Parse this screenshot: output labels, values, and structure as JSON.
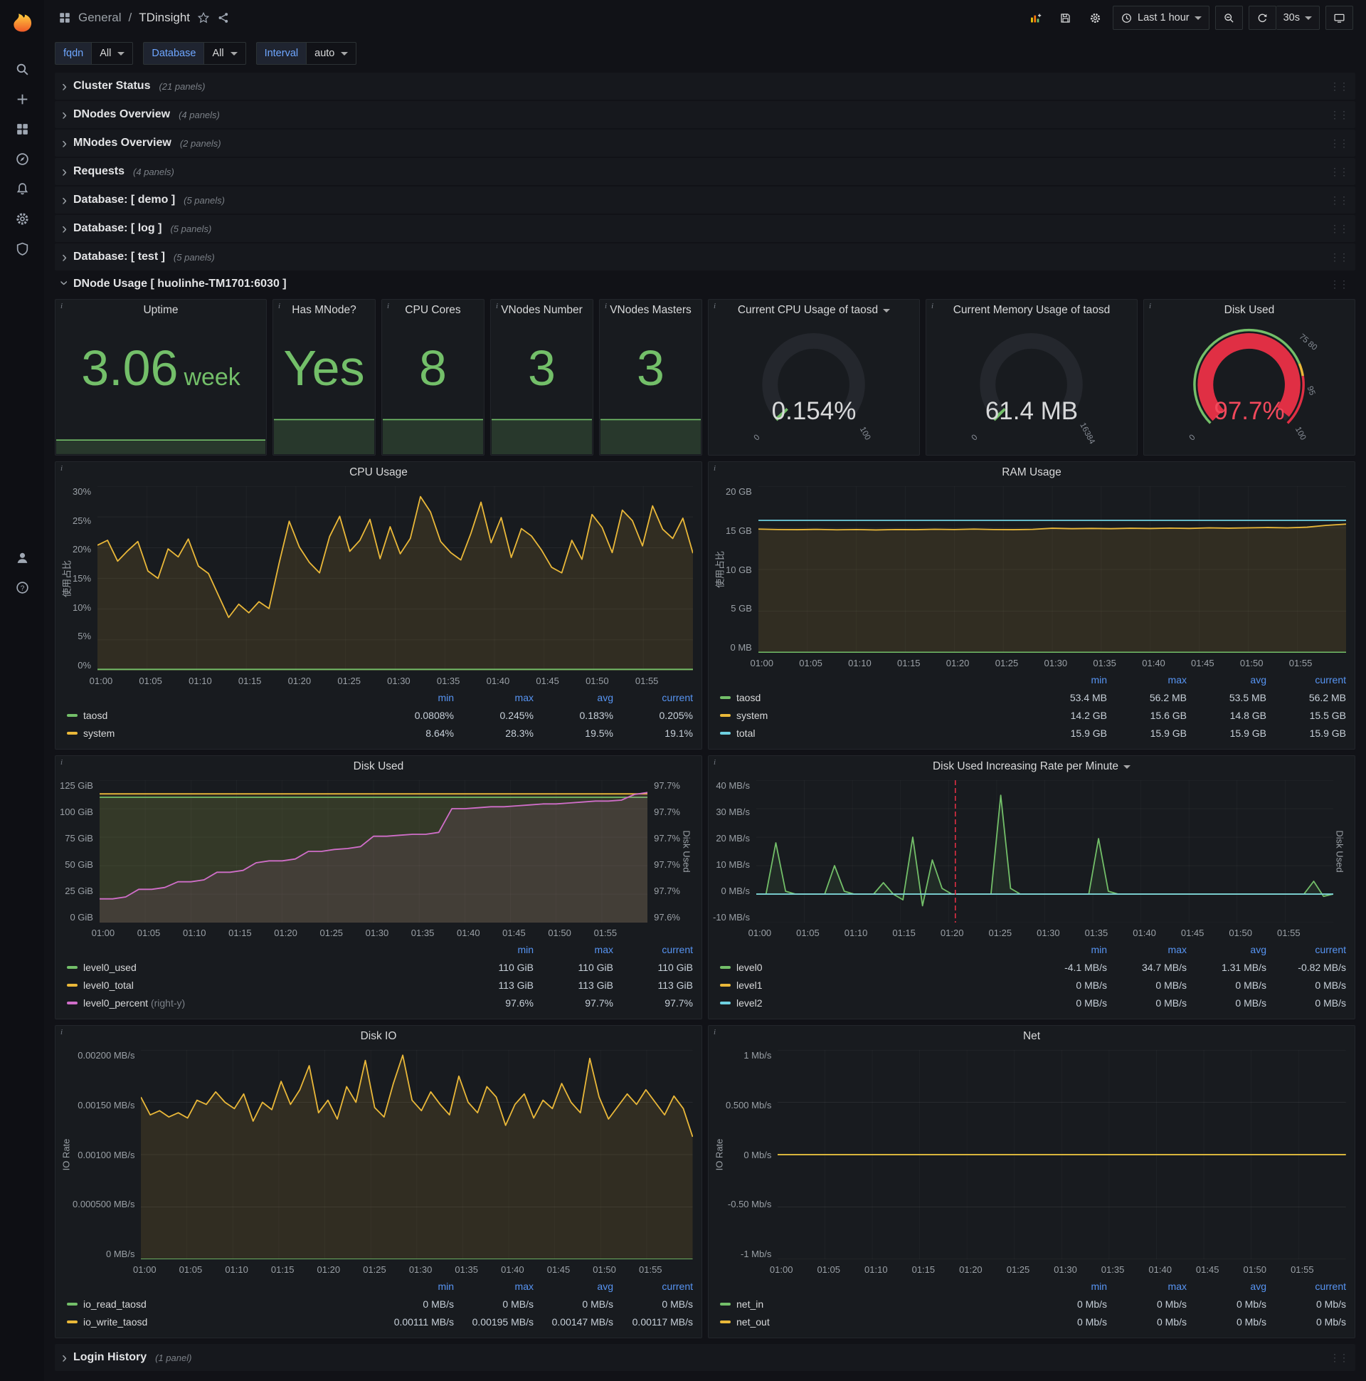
{
  "app": {
    "breadcrumb": {
      "section": "General",
      "divider": "/",
      "title": "TDinsight"
    },
    "toolbar": {
      "time_range": "Last 1 hour",
      "refresh": "30s"
    }
  },
  "variables": [
    {
      "label": "fqdn",
      "value": "All"
    },
    {
      "label": "Database",
      "value": "All"
    },
    {
      "label": "Interval",
      "value": "auto"
    }
  ],
  "collapsed_rows": [
    {
      "title": "Cluster Status",
      "count": "(21 panels)"
    },
    {
      "title": "DNodes Overview",
      "count": "(4 panels)"
    },
    {
      "title": "MNodes Overview",
      "count": "(2 panels)"
    },
    {
      "title": "Requests",
      "count": "(4 panels)"
    },
    {
      "title": "Database: [ demo ]",
      "count": "(5 panels)"
    },
    {
      "title": "Database: [ log ]",
      "count": "(5 panels)"
    },
    {
      "title": "Database: [ test ]",
      "count": "(5 panels)"
    }
  ],
  "expanded_row": {
    "title": "DNode Usage [ huolinhe-TM1701:6030 ]"
  },
  "footer_row": {
    "title": "Login History",
    "count": "(1 panel)"
  },
  "stat_panels": [
    {
      "title": "Uptime",
      "value": "3.06",
      "suffix": "week",
      "spark": 0.1
    },
    {
      "title": "Has MNode?",
      "value": "Yes",
      "suffix": "",
      "spark": 0.25
    },
    {
      "title": "CPU Cores",
      "value": "8",
      "suffix": "",
      "spark": 0.25
    },
    {
      "title": "VNodes Number",
      "value": "3",
      "suffix": "",
      "spark": 0.25
    },
    {
      "title": "VNodes Masters",
      "value": "3",
      "suffix": "",
      "spark": 0.25
    }
  ],
  "gauge_panels": [
    {
      "title": "Current CPU Usage of taosd",
      "has_menu": true,
      "value": "0.154%",
      "fraction": 0.00154,
      "value_color": "#d8d9da",
      "arc_color": "#73bf69",
      "labels": [
        {
          "text": "0",
          "pos": "min"
        },
        {
          "text": "100",
          "pos": "max"
        }
      ]
    },
    {
      "title": "Current Memory Usage of taosd",
      "has_menu": false,
      "value": "61.4 MB",
      "fraction": 0.0037,
      "value_color": "#d8d9da",
      "arc_color": "#73bf69",
      "labels": [
        {
          "text": "0",
          "pos": "min"
        },
        {
          "text": "16384",
          "pos": "max"
        }
      ]
    },
    {
      "title": "Disk Used",
      "has_menu": false,
      "value": "97.7%",
      "fraction": 0.977,
      "value_color": "#f2495c",
      "arc_color": "#e02f44",
      "thresholds": [
        {
          "from": 0,
          "to": 0.75,
          "color": "#73bf69"
        },
        {
          "from": 0.75,
          "to": 0.8,
          "color": "#eab839"
        },
        {
          "from": 0.8,
          "to": 1,
          "color": "#e02f44"
        }
      ],
      "labels": [
        {
          "text": "0",
          "pos": "min"
        },
        {
          "text": "75 80",
          "pos": "t1"
        },
        {
          "text": "95",
          "pos": "t2"
        },
        {
          "text": "100",
          "pos": "max"
        }
      ]
    }
  ],
  "chart_data": [
    {
      "id": "cpu-usage",
      "type": "line",
      "title": "CPU Usage",
      "has_menu": false,
      "ylabel": "使用占比",
      "ylim": [
        0,
        30
      ],
      "y_ticks": [
        "30%",
        "25%",
        "20%",
        "15%",
        "10%",
        "5%",
        "0%"
      ],
      "x_ticks": [
        "01:00",
        "01:05",
        "01:10",
        "01:15",
        "01:20",
        "01:25",
        "01:30",
        "01:35",
        "01:40",
        "01:45",
        "01:50",
        "01:55"
      ],
      "series": [
        {
          "name": "system",
          "color": "#eab839",
          "fill": 0.12,
          "values": [
            20.4,
            21.2,
            17.8,
            19.5,
            21.0,
            16.2,
            15.0,
            19.8,
            18.5,
            21.4,
            17.0,
            15.8,
            12.2,
            8.64,
            10.8,
            9.4,
            11.2,
            10.1,
            17.5,
            24.3,
            20.1,
            17.6,
            15.9,
            21.8,
            25.1,
            19.4,
            21.2,
            24.6,
            18.2,
            23.4,
            19.0,
            21.5,
            28.3,
            25.8,
            21.0,
            19.2,
            18.0,
            22.3,
            27.4,
            20.8,
            24.9,
            18.4,
            23.1,
            21.9,
            19.6,
            16.8,
            15.9,
            21.2,
            18.1,
            25.4,
            23.3,
            19.2,
            26.1,
            24.4,
            20.3,
            26.8,
            23.0,
            21.5,
            24.8,
            19.1
          ]
        },
        {
          "name": "taosd",
          "color": "#73bf69",
          "values": [
            0.2,
            0.2
          ]
        }
      ],
      "legend": {
        "columns": [
          "min",
          "max",
          "avg",
          "current"
        ],
        "rows": [
          {
            "name": "taosd",
            "color": "#73bf69",
            "values": [
              "0.0808%",
              "0.245%",
              "0.183%",
              "0.205%"
            ]
          },
          {
            "name": "system",
            "color": "#eab839",
            "values": [
              "8.64%",
              "28.3%",
              "19.5%",
              "19.1%"
            ]
          }
        ]
      }
    },
    {
      "id": "ram-usage",
      "type": "line",
      "title": "RAM Usage",
      "has_menu": false,
      "ylabel": "使用占比",
      "ylim": [
        0,
        20
      ],
      "y_ticks": [
        "20 GB",
        "15 GB",
        "10 GB",
        "5 GB",
        "0 MB"
      ],
      "x_ticks": [
        "01:00",
        "01:05",
        "01:10",
        "01:15",
        "01:20",
        "01:25",
        "01:30",
        "01:35",
        "01:40",
        "01:45",
        "01:50",
        "01:55"
      ],
      "series": [
        {
          "name": "system",
          "color": "#eab839",
          "fill": 0.12,
          "values": [
            14.85,
            14.8,
            14.78,
            14.82,
            14.76,
            14.8,
            14.75,
            14.8,
            14.78,
            14.83,
            14.8,
            14.85,
            14.8,
            14.78,
            14.82,
            14.95,
            14.9,
            14.93,
            14.9,
            14.95,
            14.92,
            14.97,
            14.93,
            15.0,
            14.96,
            15.0,
            15.04,
            15.0,
            15.08,
            15.3,
            15.45
          ]
        },
        {
          "name": "total",
          "color": "#6ed0e0",
          "values": [
            15.9,
            15.9
          ]
        },
        {
          "name": "taosd",
          "color": "#73bf69",
          "values": [
            0.055,
            0.055
          ]
        }
      ],
      "legend": {
        "columns": [
          "min",
          "max",
          "avg",
          "current"
        ],
        "rows": [
          {
            "name": "taosd",
            "color": "#73bf69",
            "values": [
              "53.4 MB",
              "56.2 MB",
              "53.5 MB",
              "56.2 MB"
            ]
          },
          {
            "name": "system",
            "color": "#eab839",
            "values": [
              "14.2 GB",
              "15.6 GB",
              "14.8 GB",
              "15.5 GB"
            ]
          },
          {
            "name": "total",
            "color": "#6ed0e0",
            "values": [
              "15.9 GB",
              "15.9 GB",
              "15.9 GB",
              "15.9 GB"
            ]
          }
        ]
      }
    },
    {
      "id": "disk-used",
      "type": "line",
      "title": "Disk Used",
      "has_menu": false,
      "ylabel": "",
      "ylim": [
        0,
        125
      ],
      "y_ticks": [
        "125 GiB",
        "100 GiB",
        "75 GiB",
        "50 GiB",
        "25 GiB",
        "0 GiB"
      ],
      "right_ticks": [
        "97.7%",
        "97.7%",
        "97.7%",
        "97.7%",
        "97.7%",
        "97.6%"
      ],
      "right_label": "Disk Used",
      "x_ticks": [
        "01:00",
        "01:05",
        "01:10",
        "01:15",
        "01:20",
        "01:25",
        "01:30",
        "01:35",
        "01:40",
        "01:45",
        "01:50",
        "01:55"
      ],
      "series": [
        {
          "name": "level0_total",
          "color": "#eab839",
          "fill": 0.1,
          "values": [
            113,
            113
          ]
        },
        {
          "name": "level0_used",
          "color": "#73bf69",
          "fill": 0.1,
          "values": [
            110,
            110
          ]
        },
        {
          "name": "level0_percent",
          "color": "#d06ec9",
          "fill": 0.1,
          "ylim": [
            97.575,
            97.725
          ],
          "values": [
            97.6,
            97.6,
            97.602,
            97.61,
            97.61,
            97.612,
            97.618,
            97.618,
            97.62,
            97.628,
            97.628,
            97.63,
            97.638,
            97.64,
            97.64,
            97.642,
            97.65,
            97.65,
            97.652,
            97.653,
            97.655,
            97.666,
            97.666,
            97.667,
            97.668,
            97.668,
            97.67,
            97.695,
            97.695,
            97.696,
            97.697,
            97.697,
            97.698,
            97.699,
            97.7,
            97.7,
            97.701,
            97.702,
            97.703,
            97.703,
            97.704,
            97.71,
            97.712
          ]
        }
      ],
      "legend": {
        "columns": [
          "min",
          "max",
          "current"
        ],
        "rows": [
          {
            "name": "level0_used",
            "color": "#73bf69",
            "values": [
              "110 GiB",
              "110 GiB",
              "110 GiB"
            ]
          },
          {
            "name": "level0_total",
            "color": "#eab839",
            "values": [
              "113 GiB",
              "113 GiB",
              "113 GiB"
            ]
          },
          {
            "name": "level0_percent",
            "color": "#d06ec9",
            "suffix": " (right-y)",
            "values": [
              "97.6%",
              "97.7%",
              "97.7%"
            ]
          }
        ]
      }
    },
    {
      "id": "disk-used-increasing-rate",
      "type": "line",
      "title": "Disk Used Increasing Rate per Minute",
      "has_menu": true,
      "ylabel": "",
      "ylim": [
        -10,
        40
      ],
      "y_ticks": [
        "40 MB/s",
        "30 MB/s",
        "20 MB/s",
        "10 MB/s",
        "0 MB/s",
        "-10 MB/s"
      ],
      "right_label": "Disk Used",
      "annotation_x": 0.345,
      "x_ticks": [
        "01:00",
        "01:05",
        "01:10",
        "01:15",
        "01:20",
        "01:25",
        "01:30",
        "01:35",
        "01:40",
        "01:45",
        "01:50",
        "01:55"
      ],
      "series": [
        {
          "name": "level0",
          "color": "#73bf69",
          "fill": 0.1,
          "values": [
            0,
            0,
            18,
            1,
            0,
            0,
            0,
            0,
            10,
            1,
            0,
            0,
            0,
            4,
            0,
            -2,
            20,
            -4.1,
            12,
            2,
            0,
            0,
            0,
            0,
            0,
            34.7,
            2,
            0,
            0,
            0,
            0,
            0,
            0,
            0,
            0,
            19.5,
            1,
            0,
            0,
            0,
            0,
            0,
            0,
            0,
            0,
            0,
            0,
            0,
            0,
            0,
            0,
            0,
            0,
            0,
            0,
            0,
            0,
            4.5,
            -0.8,
            0
          ]
        },
        {
          "name": "level1",
          "color": "#eab839",
          "values": [
            0,
            0
          ]
        },
        {
          "name": "level2",
          "color": "#6ed0e0",
          "values": [
            0,
            0
          ]
        }
      ],
      "legend": {
        "columns": [
          "min",
          "max",
          "avg",
          "current"
        ],
        "rows": [
          {
            "name": "level0",
            "color": "#73bf69",
            "values": [
              "-4.1 MB/s",
              "34.7 MB/s",
              "1.31 MB/s",
              "-0.82 MB/s"
            ]
          },
          {
            "name": "level1",
            "color": "#eab839",
            "values": [
              "0 MB/s",
              "0 MB/s",
              "0 MB/s",
              "0 MB/s"
            ]
          },
          {
            "name": "level2",
            "color": "#6ed0e0",
            "values": [
              "0 MB/s",
              "0 MB/s",
              "0 MB/s",
              "0 MB/s"
            ]
          }
        ]
      }
    },
    {
      "id": "disk-io",
      "type": "line",
      "title": "Disk IO",
      "has_menu": false,
      "ylabel": "IO Rate",
      "ylim": [
        0,
        0.002
      ],
      "y_ticks": [
        "0.00200 MB/s",
        "0.00150 MB/s",
        "0.00100 MB/s",
        "0.000500 MB/s",
        "0 MB/s"
      ],
      "x_ticks": [
        "01:00",
        "01:05",
        "01:10",
        "01:15",
        "01:20",
        "01:25",
        "01:30",
        "01:35",
        "01:40",
        "01:45",
        "01:50",
        "01:55"
      ],
      "series": [
        {
          "name": "io_write_taosd",
          "color": "#eab839",
          "fill": 0.12,
          "values": [
            0.00155,
            0.00138,
            0.00142,
            0.00136,
            0.0014,
            0.00135,
            0.00152,
            0.00148,
            0.0016,
            0.0015,
            0.00144,
            0.00158,
            0.00132,
            0.0015,
            0.00143,
            0.0017,
            0.00148,
            0.00162,
            0.00185,
            0.0014,
            0.00152,
            0.00134,
            0.00165,
            0.0015,
            0.0019,
            0.00145,
            0.00136,
            0.00168,
            0.00195,
            0.00152,
            0.00142,
            0.0016,
            0.00148,
            0.00138,
            0.00175,
            0.0015,
            0.0014,
            0.00165,
            0.00155,
            0.00128,
            0.00148,
            0.00158,
            0.00135,
            0.00152,
            0.00144,
            0.00168,
            0.0015,
            0.0014,
            0.00192,
            0.00155,
            0.00134,
            0.00146,
            0.00158,
            0.00148,
            0.00162,
            0.0015,
            0.00138,
            0.00156,
            0.00144,
            0.00117
          ]
        },
        {
          "name": "io_read_taosd",
          "color": "#73bf69",
          "values": [
            0,
            0
          ]
        }
      ],
      "legend": {
        "columns": [
          "min",
          "max",
          "avg",
          "current"
        ],
        "rows": [
          {
            "name": "io_read_taosd",
            "color": "#73bf69",
            "values": [
              "0 MB/s",
              "0 MB/s",
              "0 MB/s",
              "0 MB/s"
            ]
          },
          {
            "name": "io_write_taosd",
            "color": "#eab839",
            "values": [
              "0.00111 MB/s",
              "0.00195 MB/s",
              "0.00147 MB/s",
              "0.00117 MB/s"
            ]
          }
        ]
      }
    },
    {
      "id": "net",
      "type": "line",
      "title": "Net",
      "has_menu": false,
      "ylabel": "IO Rate",
      "ylim": [
        -1,
        1
      ],
      "y_ticks": [
        "1 Mb/s",
        "0.500 Mb/s",
        "0 Mb/s",
        "-0.50 Mb/s",
        "-1 Mb/s"
      ],
      "x_ticks": [
        "01:00",
        "01:05",
        "01:10",
        "01:15",
        "01:20",
        "01:25",
        "01:30",
        "01:35",
        "01:40",
        "01:45",
        "01:50",
        "01:55"
      ],
      "series": [
        {
          "name": "net_in",
          "color": "#73bf69",
          "values": [
            0,
            0
          ]
        },
        {
          "name": "net_out",
          "color": "#eab839",
          "values": [
            0,
            0
          ]
        }
      ],
      "legend": {
        "columns": [
          "min",
          "max",
          "avg",
          "current"
        ],
        "rows": [
          {
            "name": "net_in",
            "color": "#73bf69",
            "values": [
              "0 Mb/s",
              "0 Mb/s",
              "0 Mb/s",
              "0 Mb/s"
            ]
          },
          {
            "name": "net_out",
            "color": "#eab839",
            "values": [
              "0 Mb/s",
              "0 Mb/s",
              "0 Mb/s",
              "0 Mb/s"
            ]
          }
        ]
      }
    }
  ]
}
